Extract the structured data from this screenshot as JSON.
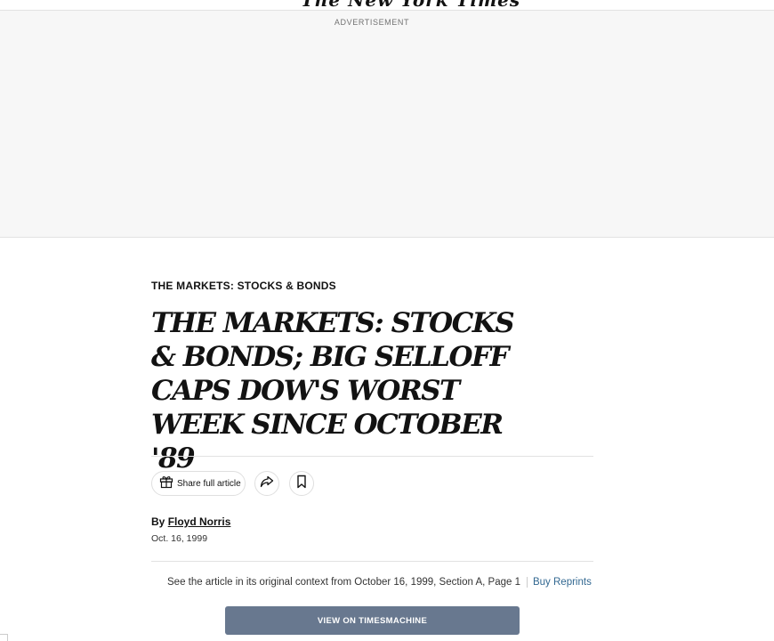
{
  "masthead": {
    "logo_text": "The New York Times"
  },
  "advertisement": {
    "label": "ADVERTISEMENT"
  },
  "article": {
    "kicker": "THE MARKETS: STOCKS & BONDS",
    "headline": "THE MARKETS: STOCKS & BONDS; BIG SELLOFF CAPS DOW'S WORST WEEK SINCE OCTOBER '89",
    "share_label": "Share full article",
    "byline_prefix": "By",
    "author": "Floyd Norris",
    "date": "Oct. 16, 1999"
  },
  "context": {
    "text": "See the article in its original context from October 16, 1999, Section A, Page 1",
    "reprints_label": "Buy Reprints",
    "timesmachine_button": "VIEW ON TIMESMACHINE"
  },
  "icons": [
    "gift-icon",
    "share-arrow-icon",
    "bookmark-icon"
  ]
}
